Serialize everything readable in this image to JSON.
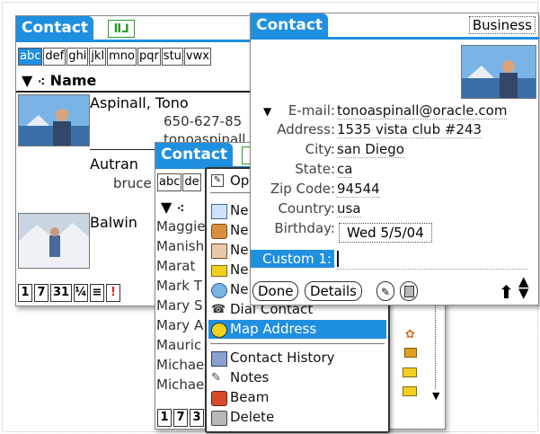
{
  "list_window": {
    "title": "Contact",
    "abc_tabs": [
      "abc",
      "def",
      "ghi",
      "jkl",
      "mno",
      "pqr",
      "stu",
      "vwx"
    ],
    "column_header": "Name",
    "entries": [
      {
        "name": "Aspinall, Tono",
        "phone": "650-627-85",
        "email_partial": "tonoaspinall"
      },
      {
        "name": "Autran",
        "detail": "bruce"
      },
      {
        "name": "Balwin"
      }
    ],
    "bottom_buttons": [
      "1",
      "7",
      "31",
      "¼",
      "≡",
      "!"
    ]
  },
  "middle_window": {
    "title": "Contact",
    "abc_tabs": [
      "abc",
      "de"
    ],
    "names": [
      "Maggie",
      "Manish",
      "Marat",
      "Mark T",
      "Mary S",
      "Mary A",
      "Mauric",
      "Michae",
      "Michae"
    ],
    "bottom_buttons": [
      "1",
      "7",
      "3"
    ]
  },
  "context_menu": {
    "items_top": [
      {
        "label": "Op",
        "icon": "edit-icon"
      },
      {
        "label": "Ne",
        "icon": "card-icon"
      },
      {
        "label": "Ne",
        "icon": "phone-icon"
      },
      {
        "label": "Ne",
        "icon": "person-icon"
      },
      {
        "label": "Ne",
        "icon": "envelope-icon"
      },
      {
        "label": "Ne",
        "icon": "globe-icon"
      },
      {
        "label": "Dial Contact",
        "icon": "dial-icon"
      },
      {
        "label": "Map Address",
        "icon": "map-icon"
      }
    ],
    "items_bottom": [
      {
        "label": "Contact History",
        "icon": "history-icon"
      },
      {
        "label": "Notes",
        "icon": "notes-icon"
      },
      {
        "label": "Beam",
        "icon": "beam-icon"
      },
      {
        "label": "Delete",
        "icon": "trash-icon"
      }
    ],
    "selected": "Map Address"
  },
  "detail_window": {
    "title": "Contact",
    "category": "Business",
    "fields": [
      {
        "label": "E-mail:",
        "value": "tonoaspinall@oracle.com"
      },
      {
        "label": "Address:",
        "value": "1535 vista club #243"
      },
      {
        "label": "City:",
        "value": "san Diego"
      },
      {
        "label": "State:",
        "value": "ca"
      },
      {
        "label": "Zip Code:",
        "value": "94544"
      },
      {
        "label": "Country:",
        "value": "usa"
      },
      {
        "label": "Birthday:",
        "value": "Wed 5/5/04"
      }
    ],
    "custom_label": "Custom 1:",
    "buttons": {
      "done": "Done",
      "details": "Details"
    }
  },
  "colors": {
    "accent": "#1f8fe0"
  }
}
